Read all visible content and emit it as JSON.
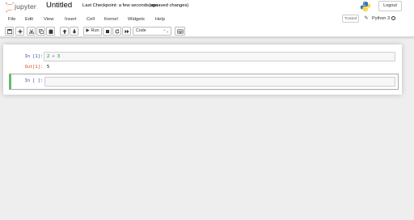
{
  "header": {
    "logo_text": "jupyter",
    "notebook_name": "Untitled",
    "checkpoint": "Last Checkpoint: a few seconds ago",
    "autosave": "(unsaved changes)",
    "logout_label": "Logout"
  },
  "menu": {
    "items": [
      "File",
      "Edit",
      "View",
      "Insert",
      "Cell",
      "Kernel",
      "Widgets",
      "Help"
    ],
    "trusted_label": "Trusted",
    "kernel_name": "Python 3"
  },
  "toolbar": {
    "run_label": "Run",
    "cell_type": "Code"
  },
  "cells": [
    {
      "in_prompt": "In [1]:",
      "code": {
        "a": "2",
        "op": "+",
        "b": "3"
      },
      "out_prompt": "Out[1]:",
      "output": "5"
    },
    {
      "in_prompt": "In [ ]:",
      "code": ""
    }
  ],
  "colors": {
    "in_prompt": "#303F9F",
    "out_prompt": "#D84315",
    "selected_cell_border": "#66bb6a",
    "jupyter_orange": "#F37726"
  },
  "icons": [
    "jupyter-logo-icon",
    "python-logo-icon",
    "pencil-icon",
    "kernel-idle-icon",
    "save-icon",
    "plus-icon",
    "cut-icon",
    "copy-icon",
    "paste-icon",
    "arrow-up-icon",
    "arrow-down-icon",
    "play-icon",
    "stop-icon",
    "restart-icon",
    "fast-forward-icon",
    "keyboard-icon"
  ]
}
